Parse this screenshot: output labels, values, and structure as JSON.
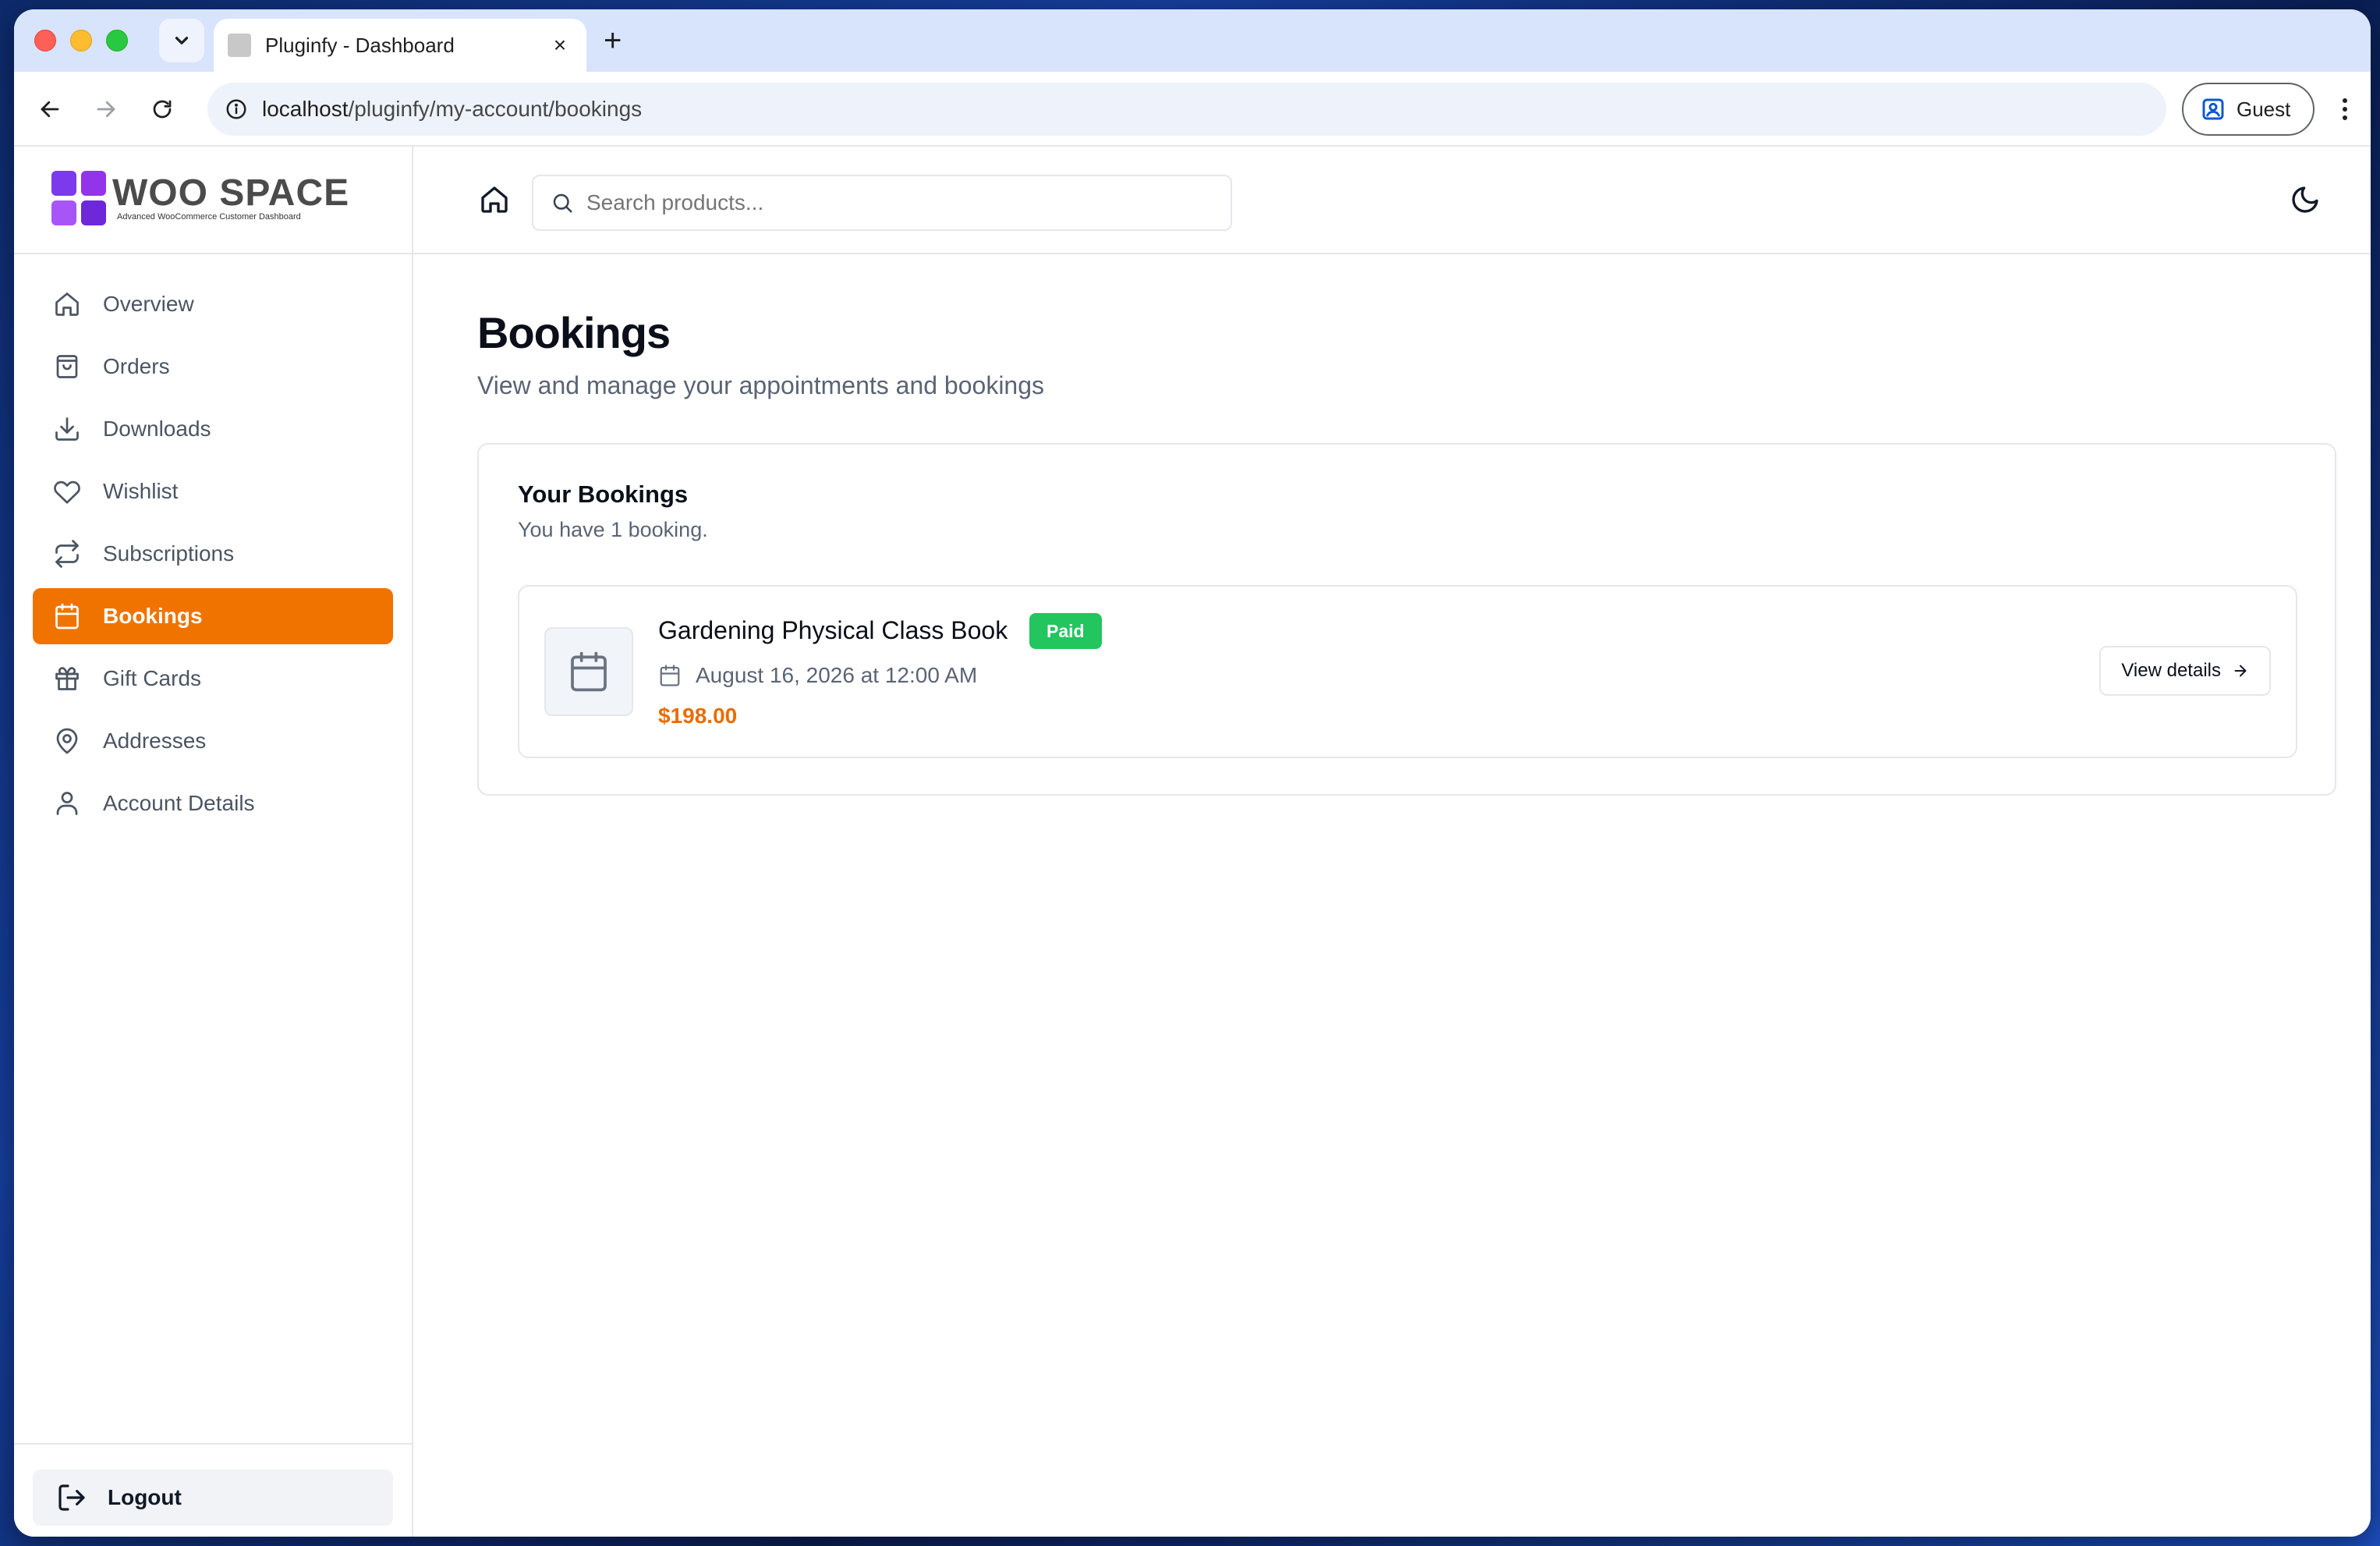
{
  "browser": {
    "tab_title": "Pluginfy - Dashboard",
    "tab_close": "×",
    "new_tab": "+",
    "url_host": "localhost",
    "url_path": "/pluginfy/my-account/bookings",
    "profile_label": "Guest"
  },
  "brand": {
    "name": "WOO SPACE",
    "tagline": "Advanced WooCommerce Customer Dashboard",
    "accent": "#f07300",
    "logo_color": "#7c3aed"
  },
  "sidebar": {
    "items": [
      {
        "label": "Overview",
        "icon": "home-icon"
      },
      {
        "label": "Orders",
        "icon": "shopping-bag-icon"
      },
      {
        "label": "Downloads",
        "icon": "download-icon"
      },
      {
        "label": "Wishlist",
        "icon": "heart-icon"
      },
      {
        "label": "Subscriptions",
        "icon": "repeat-icon"
      },
      {
        "label": "Bookings",
        "icon": "calendar-icon",
        "active": true
      },
      {
        "label": "Gift Cards",
        "icon": "gift-icon"
      },
      {
        "label": "Addresses",
        "icon": "map-pin-icon"
      },
      {
        "label": "Account Details",
        "icon": "user-icon"
      }
    ],
    "logout_label": "Logout"
  },
  "header": {
    "search_placeholder": "Search products..."
  },
  "page": {
    "title": "Bookings",
    "subtitle": "View and manage your appointments and bookings"
  },
  "bookings_card": {
    "title": "Your Bookings",
    "subtitle": "You have 1 booking.",
    "items": [
      {
        "name": "Gardening Physical Class Book",
        "status": "Paid",
        "status_color": "#22c55e",
        "date": "August 16, 2026 at 12:00 AM",
        "price": "$198.00",
        "action_label": "View details"
      }
    ]
  }
}
